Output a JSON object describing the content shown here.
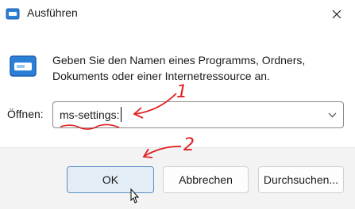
{
  "window": {
    "title": "Ausführen",
    "close_icon": "close-icon",
    "app_icon": "run-icon"
  },
  "content": {
    "description": "Geben Sie den Namen eines Programms, Ordners,\nDokuments oder einer Internetressource an.",
    "run_icon": "run-icon"
  },
  "open": {
    "label": "Öffnen:",
    "value": "ms-settings:",
    "dropdown_icon": "chevron-down-icon"
  },
  "buttons": {
    "ok": "OK",
    "cancel": "Abbrechen",
    "browse": "Durchsuchen..."
  },
  "annotations": {
    "step1": "1",
    "step2": "2",
    "color": "#e02222"
  },
  "colors": {
    "ok_border": "#5b8fc7",
    "ok_bg": "#e3edf6",
    "footer_bg": "#f3f3f3"
  }
}
